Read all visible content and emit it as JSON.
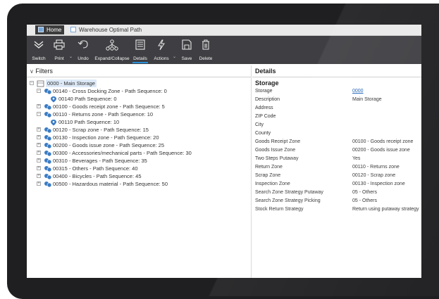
{
  "tabs": [
    {
      "label": "Home",
      "active": true
    },
    {
      "label": "Warehouse Optimal Path",
      "active": false
    }
  ],
  "toolbar": {
    "switch": "Switch",
    "print": "Print",
    "undo": "Undo",
    "expand_collapse": "Expand/Collapse",
    "details": "Details",
    "actions": "Actions",
    "save": "Save",
    "delete": "Delete"
  },
  "filters": {
    "title": "Filters",
    "tree": [
      {
        "label": "0000 - Main Storage",
        "level": 0,
        "expander": "−",
        "icon": "storage-icon"
      },
      {
        "label": "00140 - Cross Docking Zone - Path Sequence: 0",
        "level": 1,
        "expander": "−",
        "icon": "zone-icon"
      },
      {
        "label": "00140 Path Sequence: 0",
        "level": 2,
        "expander": "",
        "icon": "location-pin-icon"
      },
      {
        "label": "00100 - Goods receipt zone - Path Sequence: 5",
        "level": 1,
        "expander": "+",
        "icon": "zone-icon"
      },
      {
        "label": "00110 - Returns zone - Path Sequence: 10",
        "level": 1,
        "expander": "−",
        "icon": "zone-icon"
      },
      {
        "label": "00110 Path Sequence: 10",
        "level": 2,
        "expander": "",
        "icon": "location-pin-icon"
      },
      {
        "label": "00120 - Scrap zone - Path Sequence: 15",
        "level": 1,
        "expander": "+",
        "icon": "zone-icon"
      },
      {
        "label": "00130 - Inspection zone - Path Sequence: 20",
        "level": 1,
        "expander": "+",
        "icon": "zone-icon"
      },
      {
        "label": "00200 - Goods issue zone - Path Sequence: 25",
        "level": 1,
        "expander": "+",
        "icon": "zone-icon"
      },
      {
        "label": "00300 - Accessories/mechanical parts - Path Sequence: 30",
        "level": 1,
        "expander": "+",
        "icon": "zone-icon"
      },
      {
        "label": "00310 - Beverages - Path Sequence: 35",
        "level": 1,
        "expander": "+",
        "icon": "zone-icon"
      },
      {
        "label": "00315 - Others - Path Sequence: 40",
        "level": 1,
        "expander": "+",
        "icon": "zone-icon"
      },
      {
        "label": "00400 - Bicycles - Path Sequence: 45",
        "level": 1,
        "expander": "+",
        "icon": "zone-icon"
      },
      {
        "label": "00500 - Hazardous material - Path Sequence: 50",
        "level": 1,
        "expander": "+",
        "icon": "zone-icon"
      }
    ]
  },
  "details": {
    "title": "Details",
    "section": "Storage",
    "fields": [
      {
        "key": "Storage",
        "value": "0000",
        "link": true
      },
      {
        "key": "Description",
        "value": "Main Storage"
      },
      {
        "key": "Address",
        "value": ""
      },
      {
        "key": "ZIP Code",
        "value": ""
      },
      {
        "key": "City",
        "value": ""
      },
      {
        "key": "County",
        "value": ""
      },
      {
        "key": "Goods Receipt Zone",
        "value": "00100 - Goods receipt zone"
      },
      {
        "key": "Goods Issue Zone",
        "value": "00200 - Goods issue zone"
      },
      {
        "key": "Two Steps Putaway",
        "value": "Yes"
      },
      {
        "key": "Return Zone",
        "value": "00110 - Returns zone"
      },
      {
        "key": "Scrap Zone",
        "value": "00120 - Scrap zone"
      },
      {
        "key": "Inspection Zone",
        "value": "00130 - Inspection zone"
      },
      {
        "key": "Search Zone Strategy Putaway",
        "value": "05 - Others"
      },
      {
        "key": "Search Zone Strategy Picking",
        "value": "05 - Others"
      },
      {
        "key": "Stock Return Strategy",
        "value": "Return using putaway strategy"
      }
    ]
  },
  "colors": {
    "toolbar_bg": "#3f3f43",
    "accent": "#2b8fd8",
    "zone_icon": "#3b7cc4",
    "link": "#1a5fb4"
  }
}
